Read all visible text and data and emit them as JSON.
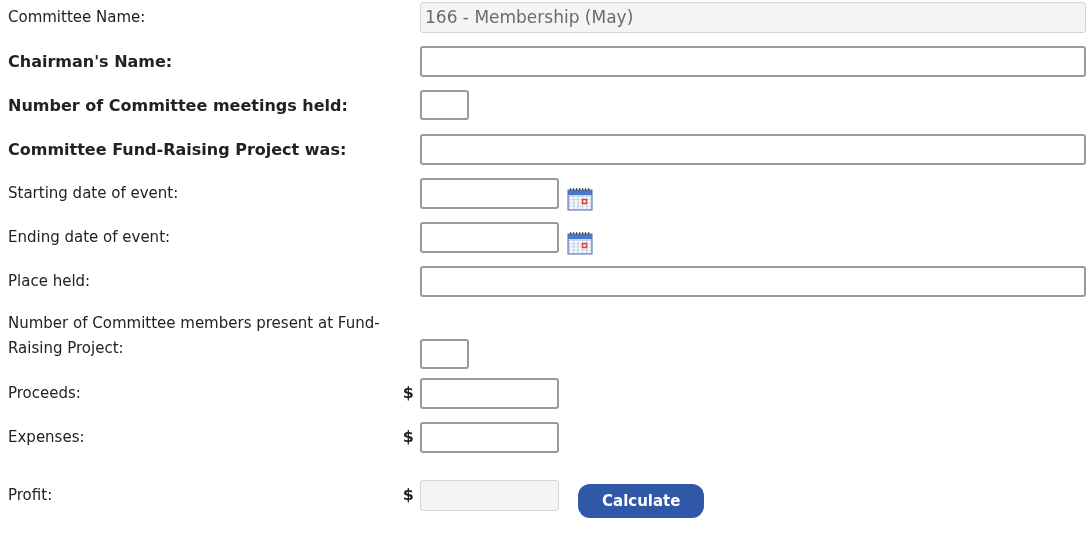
{
  "form": {
    "rows": [
      {
        "label": "Committee Name:",
        "bold": false,
        "field": {
          "kind": "wide",
          "value": "166 - Membership (May)",
          "disabled": true
        }
      },
      {
        "label": "Chairman's Name:",
        "bold": true,
        "field": {
          "kind": "wide",
          "disabled": false
        }
      },
      {
        "label": "Number of Committee meetings held:",
        "bold": true,
        "field": {
          "kind": "small",
          "disabled": false
        }
      },
      {
        "label": "Committee Fund-Raising Project was:",
        "bold": true,
        "field": {
          "kind": "wide",
          "disabled": false
        }
      },
      {
        "label": "Starting date of event:",
        "bold": false,
        "field": {
          "kind": "date",
          "disabled": false
        }
      },
      {
        "label": "Ending date of event:",
        "bold": false,
        "field": {
          "kind": "date",
          "disabled": false
        }
      },
      {
        "label": "Place held:",
        "bold": false,
        "field": {
          "kind": "wide",
          "disabled": false
        }
      },
      {
        "label": "Number of Committee members present at Fund-Raising Project:",
        "bold": false,
        "field": {
          "kind": "small",
          "disabled": false
        }
      },
      {
        "label": "Proceeds:",
        "bold": false,
        "currency": "$",
        "field": {
          "kind": "money",
          "disabled": false
        }
      },
      {
        "label": "Expenses:",
        "bold": false,
        "currency": "$",
        "field": {
          "kind": "money",
          "disabled": false
        }
      },
      {
        "label": "Profit:",
        "bold": false,
        "currency": "$",
        "field": {
          "kind": "money",
          "disabled": true
        },
        "button": "Calculate"
      }
    ]
  }
}
